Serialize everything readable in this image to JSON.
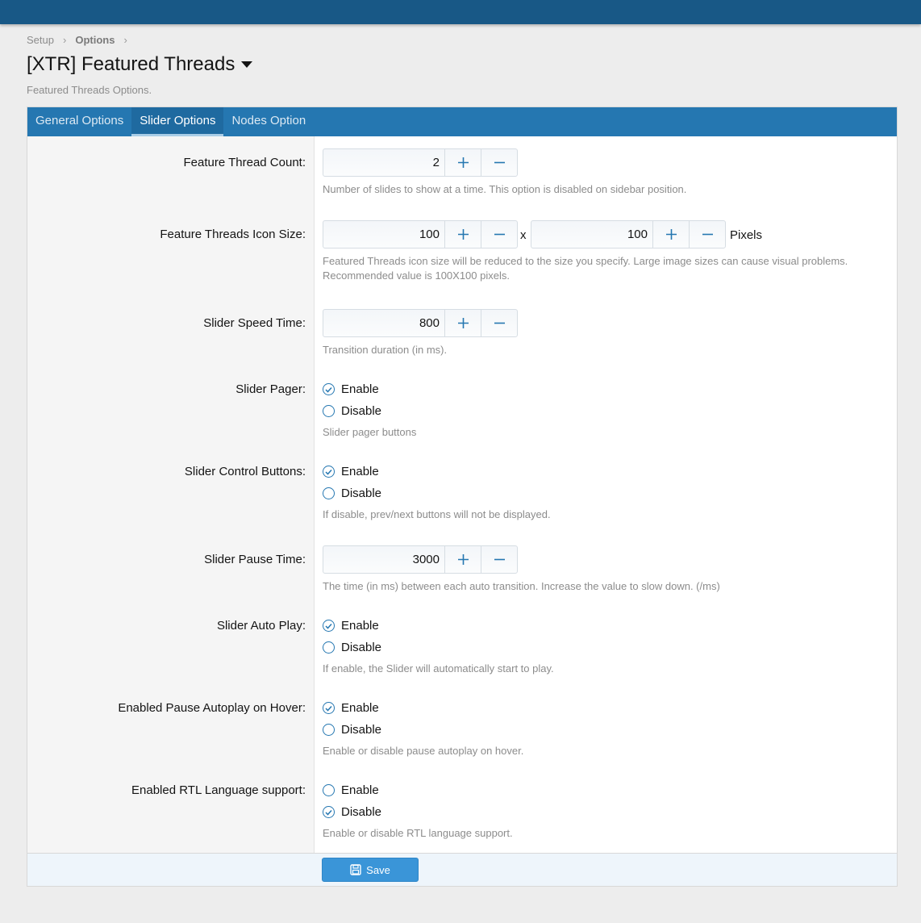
{
  "breadcrumb": {
    "items": [
      "Setup",
      "Options"
    ]
  },
  "page": {
    "title": "[XTR] Featured Threads",
    "description": "Featured Threads Options."
  },
  "tabs": [
    {
      "label": "General Options",
      "active": false
    },
    {
      "label": "Slider Options",
      "active": true
    },
    {
      "label": "Nodes Option",
      "active": false
    }
  ],
  "fields": {
    "thread_count": {
      "label": "Feature Thread Count:",
      "value": "2",
      "hint": "Number of slides to show at a time. This option is disabled on sidebar position."
    },
    "icon_size": {
      "label": "Feature Threads Icon Size:",
      "width_value": "100",
      "height_value": "100",
      "separator": "x",
      "unit": "Pixels",
      "hint_line1": "Featured Threads icon size will be reduced to the size you specify. Large image sizes can cause visual problems.",
      "hint_line2": "Recommended value is 100X100 pixels."
    },
    "speed_time": {
      "label": "Slider Speed Time:",
      "value": "800",
      "hint": "Transition duration (in ms)."
    },
    "pager": {
      "label": "Slider Pager:",
      "enable": "Enable",
      "disable": "Disable",
      "selected": "enable",
      "hint": "Slider pager buttons"
    },
    "control_buttons": {
      "label": "Slider Control Buttons:",
      "enable": "Enable",
      "disable": "Disable",
      "selected": "enable",
      "hint": "If disable, prev/next buttons will not be displayed."
    },
    "pause_time": {
      "label": "Slider Pause Time:",
      "value": "3000",
      "hint": "The time (in ms) between each auto transition. Increase the value to slow down. (/ms)"
    },
    "auto_play": {
      "label": "Slider Auto Play:",
      "enable": "Enable",
      "disable": "Disable",
      "selected": "enable",
      "hint": "If enable, the Slider will automatically start to play."
    },
    "pause_on_hover": {
      "label": "Enabled Pause Autoplay on Hover:",
      "enable": "Enable",
      "disable": "Disable",
      "selected": "enable",
      "hint": "Enable or disable pause autoplay on hover."
    },
    "rtl_support": {
      "label": "Enabled RTL Language support:",
      "enable": "Enable",
      "disable": "Disable",
      "selected": "disable",
      "hint": "Enable or disable RTL language support."
    }
  },
  "footer": {
    "save_label": "Save"
  },
  "colors": {
    "accent": "#2577b1",
    "topbar": "#185886",
    "save_button": "#3a95d8"
  },
  "icons": {
    "plus": "plus-icon",
    "minus": "minus-icon",
    "save": "save-icon",
    "check": "check-icon"
  }
}
